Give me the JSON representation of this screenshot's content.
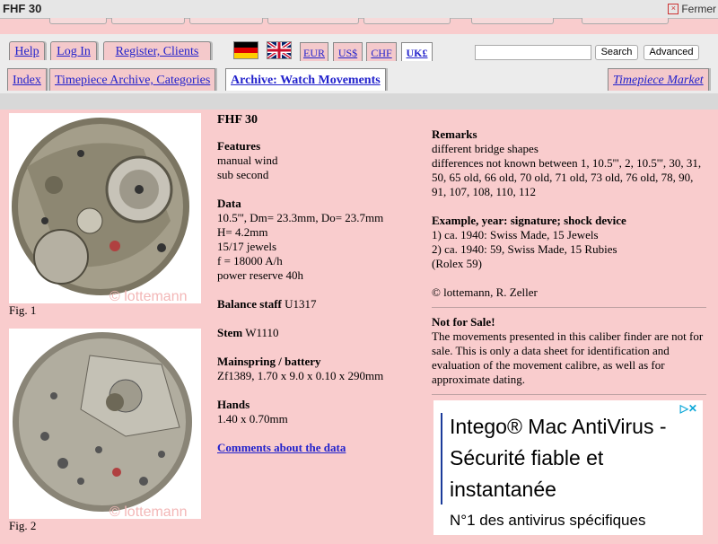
{
  "window": {
    "title": "FHF 30",
    "close_label": "Fermer"
  },
  "topnav": {
    "help": "Help",
    "login": "Log In",
    "register": "Register, Clients",
    "flags": [
      "de-flag-icon",
      "uk-flag-icon"
    ],
    "currencies": [
      "EUR",
      "US$",
      "CHF",
      "UK£"
    ],
    "selected_currency": "UK£",
    "search_placeholder": "",
    "search_button": "Search",
    "advanced_button": "Advanced"
  },
  "subnav": {
    "index": "Index",
    "categories": "Timepiece Archive, Categories",
    "movements": "Archive: Watch Movements",
    "market": "Timepiece Market"
  },
  "figures": [
    {
      "caption": "Fig. 1",
      "watermark": "© lottemann"
    },
    {
      "caption": "Fig. 2",
      "watermark": "© lottemann"
    }
  ],
  "details": {
    "title": "FHF 30",
    "features_heading": "Features",
    "features": [
      "manual wind",
      "sub second"
    ],
    "data_heading": "Data",
    "data": [
      "10.5''', Dm= 23.3mm, Do= 23.7mm",
      "H= 4.2mm",
      "15/17 jewels",
      "f = 18000 A/h",
      "power reserve 40h"
    ],
    "balance_label": "Balance staff",
    "balance_value": "U1317",
    "stem_label": "Stem",
    "stem_value": "W1110",
    "mainspring_heading": "Mainspring / battery",
    "mainspring_value": "Zf1389, 1.70 x 9.0 x 0.10 x 290mm",
    "hands_heading": "Hands",
    "hands_value": "1.40 x 0.70mm",
    "comments_link": "Comments about the data"
  },
  "remarks": {
    "heading": "Remarks",
    "lines": [
      "different bridge shapes",
      "differences not known between 1, 10.5''', 2, 10.5''', 30, 31, 50, 65 old, 66 old, 70 old, 71 old, 73 old, 76 old, 78, 90, 91, 107, 108, 110, 112"
    ],
    "example_heading": "Example, year: signature; shock device",
    "examples": [
      "1) ca. 1940: Swiss Made, 15 Jewels",
      "2) ca. 1940: 59, Swiss Made, 15 Rubies",
      "(Rolex 59)"
    ],
    "copyright": "© lottemann, R. Zeller",
    "sale_heading": "Not for Sale!",
    "sale_text": "The movements presented in this caliber finder are not for sale. This is only a data sheet for identification and evaluation of the movement calibre, as well as for approximate dating."
  },
  "ad": {
    "headline": "Intego® Mac AntiVirus - Sécurité fiable et instantanée",
    "sub": "N°1 des antivirus spécifiques"
  }
}
